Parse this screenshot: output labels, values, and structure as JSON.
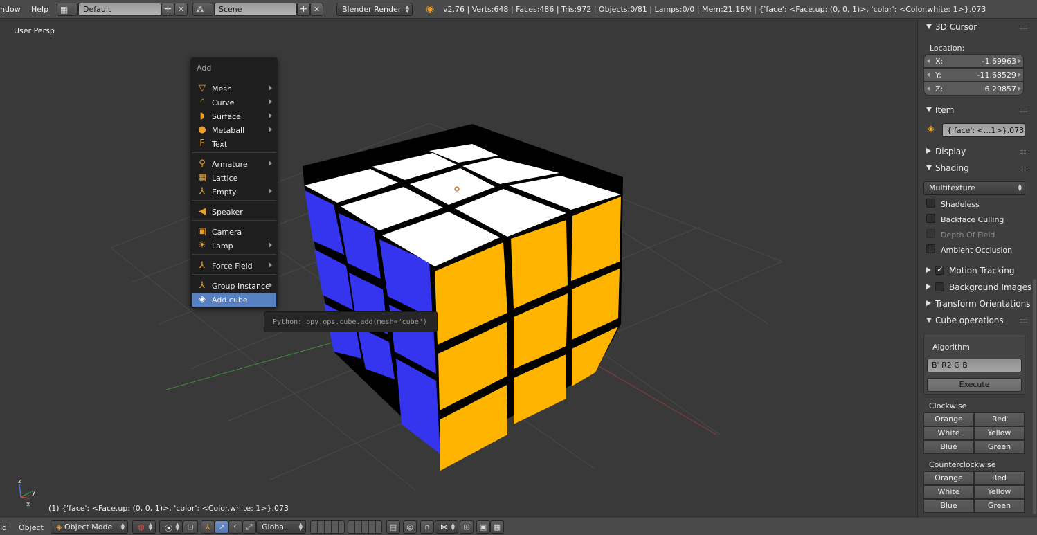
{
  "colors": {
    "accent_blue": "#5680c2",
    "menu_icon_orange": "#e8a02a",
    "cube_white": "#ffffff",
    "cube_blue": "#3535f0",
    "cube_yellow": "#ffb400"
  },
  "topbar": {
    "menu_window": "ndow",
    "menu_help": "Help",
    "layout_value": "Default",
    "scene_value": "Scene",
    "engine_value": "Blender Render",
    "stats": "v2.76 | Verts:648 | Faces:486 | Tris:972 | Objects:0/81 | Lamps:0/0 | Mem:21.16M | {'face': <Face.up: (0, 0, 1)>, 'color': <Color.white: 1>}.073",
    "add_symbol": "+",
    "close_symbol": "✕"
  },
  "viewport": {
    "persp_label": "User Persp",
    "object_info": "(1) {'face': <Face.up: (0, 0, 1)>, 'color': <Color.white: 1>}.073",
    "axis_x": "x",
    "axis_y": "y",
    "axis_z": "z"
  },
  "add_menu": {
    "title": "Add",
    "items": [
      {
        "label": "Mesh",
        "icon": "mesh-icon",
        "glyph": "▽",
        "submenu": true
      },
      {
        "label": "Curve",
        "icon": "curve-icon",
        "glyph": "◜",
        "submenu": true
      },
      {
        "label": "Surface",
        "icon": "surface-icon",
        "glyph": "◗",
        "submenu": true
      },
      {
        "label": "Metaball",
        "icon": "metaball-icon",
        "glyph": "●",
        "submenu": true
      },
      {
        "label": "Text",
        "icon": "text-icon",
        "glyph": "F",
        "submenu": false
      },
      {
        "label": "Armature",
        "icon": "armature-icon",
        "glyph": "⚲",
        "submenu": true
      },
      {
        "label": "Lattice",
        "icon": "lattice-icon",
        "glyph": "▦",
        "submenu": false
      },
      {
        "label": "Empty",
        "icon": "empty-icon",
        "glyph": "⅄",
        "submenu": true
      },
      {
        "label": "Speaker",
        "icon": "speaker-icon",
        "glyph": "◀",
        "submenu": false
      },
      {
        "label": "Camera",
        "icon": "camera-icon",
        "glyph": "▣",
        "submenu": false
      },
      {
        "label": "Lamp",
        "icon": "lamp-icon",
        "glyph": "☀",
        "submenu": true
      },
      {
        "label": "Force Field",
        "icon": "force-field-icon",
        "glyph": "⅄",
        "submenu": true
      },
      {
        "label": "Group Instance",
        "icon": "group-instance-icon",
        "glyph": "⅄",
        "submenu": true
      },
      {
        "label": "Add cube",
        "icon": "cube-icon",
        "glyph": "◈",
        "submenu": false,
        "active": true
      }
    ]
  },
  "tooltip": {
    "text": "Python: bpy.ops.cube.add(mesh=\"cube\")"
  },
  "properties": {
    "cursor": {
      "header": "3D Cursor",
      "location_label": "Location:",
      "x_label": "X:",
      "x_value": "-1.69963",
      "y_label": "Y:",
      "y_value": "-11.68529",
      "z_label": "Z:",
      "z_value": "6.29857"
    },
    "item": {
      "header": "Item",
      "name": "{'face': <...1>}.073"
    },
    "display_header": "Display",
    "shading": {
      "header": "Shading",
      "mode": "Multitexture",
      "shadeless": "Shadeless",
      "backface_culling": "Backface Culling",
      "depth_of_field": "Depth Of Field",
      "ambient_occlusion": "Ambient Occlusion"
    },
    "motion_tracking": "Motion Tracking",
    "background_images": "Background Images",
    "transform_orientations": "Transform Orientations",
    "cube_operations": {
      "header": "Cube operations",
      "algorithm_label": "Algorithm",
      "algorithm_value": "B' R2 G B",
      "execute": "Execute",
      "clockwise_label": "Clockwise",
      "clockwise": [
        "Orange",
        "Red",
        "White",
        "Yellow",
        "Blue",
        "Green"
      ],
      "counterclockwise_label": "Counterclockwise",
      "counterclockwise": [
        "Orange",
        "Red",
        "White",
        "Yellow",
        "Blue",
        "Green"
      ]
    }
  },
  "bottombar": {
    "menu_select": "ld",
    "menu_object": "Object",
    "mode": "Object Mode",
    "orientation": "Global"
  }
}
